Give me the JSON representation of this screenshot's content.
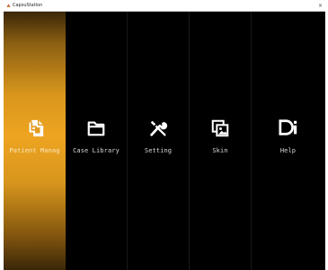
{
  "window": {
    "title": "CapsuStation",
    "close_glyph": "×"
  },
  "menu": {
    "active_index": 0,
    "accent_color": "#eea421",
    "items": [
      {
        "label": "Patient Manag",
        "icon": "patient-management-icon"
      },
      {
        "label": "Case Library",
        "icon": "folder-icon"
      },
      {
        "label": "Setting",
        "icon": "wrench-screwdriver-icon"
      },
      {
        "label": "Skin",
        "icon": "gallery-icon"
      },
      {
        "label": "Help",
        "icon": "help-document-icon"
      }
    ]
  }
}
